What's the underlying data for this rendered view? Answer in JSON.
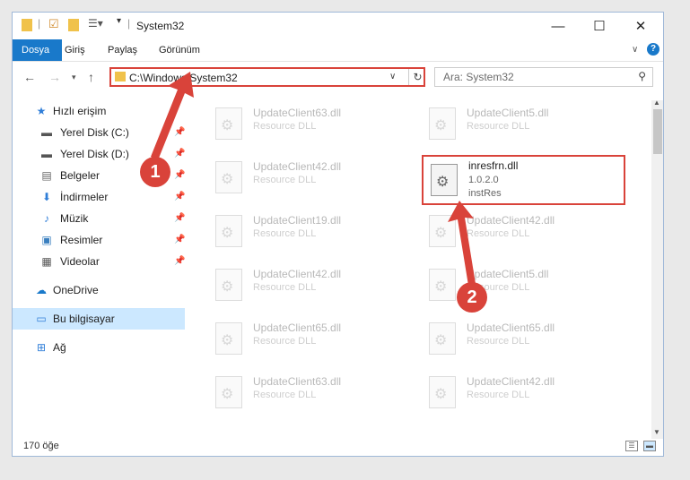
{
  "window": {
    "title": "System32"
  },
  "ribbon": {
    "tabs": [
      "Dosya",
      "Giriş",
      "Paylaş",
      "Görünüm"
    ]
  },
  "address": {
    "path": "C:\\Windows\\System32"
  },
  "search": {
    "placeholder": "Ara: System32"
  },
  "sidebar": {
    "items": [
      {
        "label": "Hızlı erişim",
        "icon": "star-icon"
      },
      {
        "label": "Yerel Disk (C:)",
        "icon": "drive-icon"
      },
      {
        "label": "Yerel Disk (D:)",
        "icon": "drive-icon"
      },
      {
        "label": "Belgeler",
        "icon": "documents-icon"
      },
      {
        "label": "İndirmeler",
        "icon": "download-icon"
      },
      {
        "label": "Müzik",
        "icon": "music-icon"
      },
      {
        "label": "Resimler",
        "icon": "pictures-icon"
      },
      {
        "label": "Videolar",
        "icon": "video-icon"
      },
      {
        "label": "OneDrive",
        "icon": "cloud-icon"
      },
      {
        "label": "Bu bilgisayar",
        "icon": "computer-icon"
      },
      {
        "label": "Ağ",
        "icon": "network-icon"
      }
    ]
  },
  "files": {
    "left": [
      {
        "name": "UpdateClient63.dll",
        "desc": "Resource DLL"
      },
      {
        "name": "UpdateClient42.dll",
        "desc": "Resource DLL"
      },
      {
        "name": "UpdateClient19.dll",
        "desc": "Resource DLL"
      },
      {
        "name": "UpdateClient42.dll",
        "desc": "Resource DLL"
      },
      {
        "name": "UpdateClient65.dll",
        "desc": "Resource DLL"
      },
      {
        "name": "UpdateClient63.dll",
        "desc": "Resource DLL"
      }
    ],
    "right": [
      {
        "name": "UpdateClient5.dll",
        "desc": "Resource DLL"
      },
      {
        "name": "UpdateClient42.dll",
        "desc": "Resource DLL"
      },
      {
        "name": "UpdateClient5.dll",
        "desc": "Resource DLL"
      },
      {
        "name": "UpdateClient65.dll",
        "desc": "Resource DLL"
      },
      {
        "name": "UpdateClient42.dll",
        "desc": "Resource DLL"
      }
    ],
    "highlighted": {
      "name": "inresfrn.dll",
      "version": "1.0.2.0",
      "company": "instRes"
    }
  },
  "status": {
    "count": "170 öğe"
  },
  "callouts": [
    "1",
    "2"
  ],
  "colors": {
    "accent": "#1979ca",
    "highlight": "#d9433a",
    "selected": "#cce8ff"
  }
}
